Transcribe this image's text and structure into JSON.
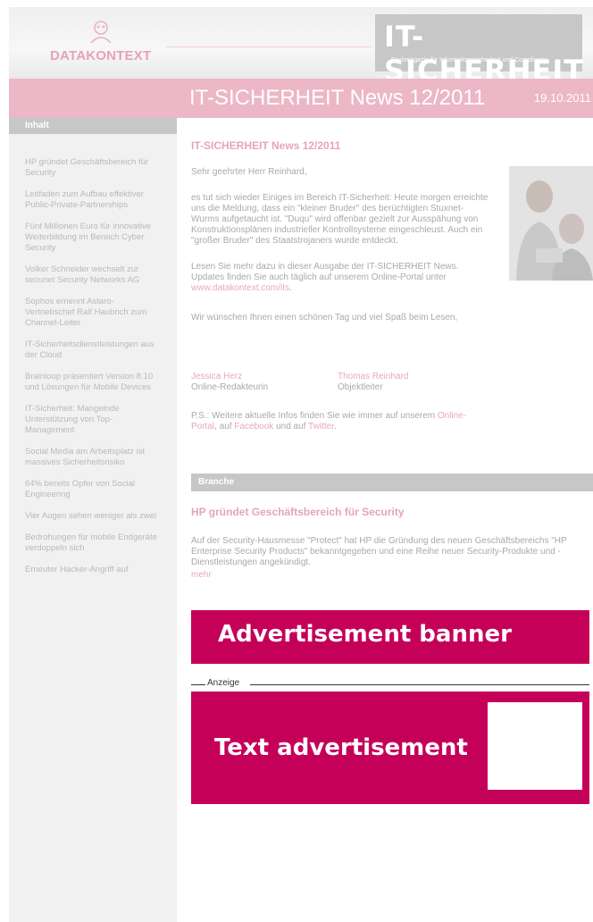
{
  "header": {
    "logo_text": "DATAKONTEXT",
    "brand_title": "IT-SICHERHEIT",
    "brand_subtitle": "Fachmagazin für Informationssicherheit und Compliance"
  },
  "titlebar": {
    "title": "IT-SICHERHEIT News 12/2011",
    "date": "19.10.2011"
  },
  "sidebar": {
    "heading": "Inhalt",
    "items": [
      "HP gründet Geschäftsbereich für Security",
      "Leitfaden zum Aufbau effektiver Public-Private-Partnerships",
      "Fünf Millionen Euro für innovative Weiterbildung im Bereich Cyber Security",
      "Volker Schneider wechselt zur secunet Security Networks AG",
      "Sophos ernennt Astaro-Vertriebschef Ralf Haubrich zum Channel-Leiter",
      "IT-Sicherheitsdienstleistungen aus der Cloud",
      "Brainloop präsentiert Version 8.10 und Lösungen für Mobile Devices",
      "IT-Sicherheit: Mangelnde Unterstützung von Top-Management",
      "Social Media am Arbeitsplatz ist massives Sicherheitsrisiko",
      "64% bereits Opfer von Social Engineering",
      "Vier Augen sehen weniger als zwei",
      "Bedrohungen für mobile Endgeräte verdoppeln sich",
      "Erneuter Hacker-Angriff auf"
    ]
  },
  "intro": {
    "title": "IT-SICHERHEIT News 12/2011",
    "greeting": "Sehr geehrter Herr Reinhard,",
    "para1": "es tut sich wieder Einiges im Bereich IT-Sicherheit: Heute morgen erreichte uns die Meldung, dass ein \"kleiner Bruder\" des berüchtigten Stuxnet-Wurms aufgetaucht ist. \"Duqu\" wird offenbar gezielt zur Ausspähung von Konstruktionsplänen industrieller Kontrollsysteme eingeschleust. Auch ein \"großer Bruder\" des Staatstrojaners wurde entdeckt.",
    "para2_before": "Lesen Sie mehr dazu in dieser Ausgabe der IT-SICHERHEIT News. Updates finden Sie auch täglich auf unserem Online-Portal unter ",
    "para2_link": "www.datakontext.com/its",
    "para2_after": ".",
    "para3": "Wir wünschen Ihnen einen schönen Tag und viel Spaß beim Lesen,",
    "signature1_name": "Jessica Herz",
    "signature1_role": "Online-Redakteurin",
    "signature2_name": "Thomas Reinhard",
    "signature2_role": "Objektleiter",
    "ps_before": "P.S.: Weitere aktuelle Infos finden Sie wie immer auf unserem ",
    "ps_link1": "Online-Portal",
    "ps_mid1": ", auf ",
    "ps_link2": "Facebook",
    "ps_mid2": " und auf ",
    "ps_link3": "Twitter",
    "ps_after": "."
  },
  "section": {
    "heading": "Branche",
    "news_title": "HP gründet Geschäftsbereich für Security",
    "news_body": "Auf der Security-Hausmesse \"Protect\" hat HP die Gründung des neuen Geschäftsbereichs \"HP Enterprise Security Products\" bekanntgegeben und eine Reihe neuer Security-Produkte und -Dienstleistungen angekündigt.",
    "news_more": "mehr"
  },
  "ads": {
    "banner_label": "Advertisement banner",
    "anzeige_label": "Anzeige",
    "text_ad_label": "Text advertisement"
  },
  "colors": {
    "accent_pink": "#ecb7c7",
    "ad_magenta": "#c50059"
  }
}
